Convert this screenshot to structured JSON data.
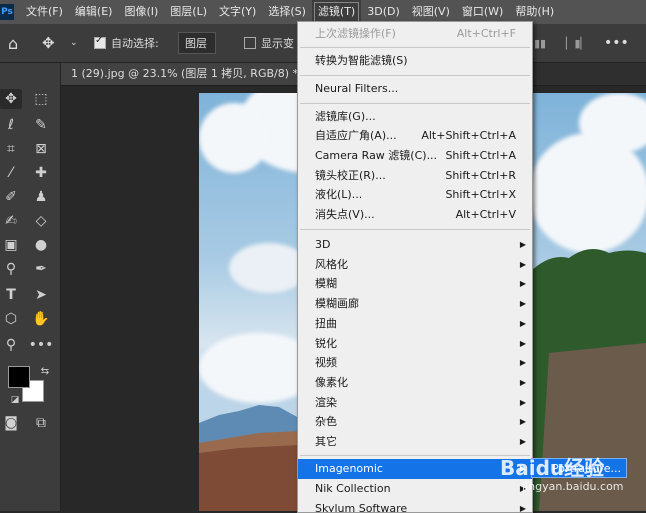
{
  "menubar": {
    "logo": "Ps",
    "items": [
      "文件(F)",
      "编辑(E)",
      "图像(I)",
      "图层(L)",
      "文字(Y)",
      "选择(S)",
      "滤镜(T)",
      "3D(D)",
      "视图(V)",
      "窗口(W)",
      "帮助(H)"
    ]
  },
  "optbar": {
    "auto_select_label": "自动选择:",
    "auto_select_value": "图层",
    "show_transform_label": "显示变"
  },
  "document": {
    "tab_title": "1 (29).jpg @ 23.1% (图层 1 拷贝, RGB/8) *"
  },
  "filter_menu": {
    "items": [
      {
        "label": "上次滤镜操作(F)",
        "shortcut": "Alt+Ctrl+F",
        "disabled": true
      },
      {
        "label": "转换为智能滤镜(S)",
        "shortcut": ""
      },
      {
        "label": "Neural Filters...",
        "shortcut": ""
      },
      {
        "label": "滤镜库(G)...",
        "shortcut": ""
      },
      {
        "label": "自适应广角(A)...",
        "shortcut": "Alt+Shift+Ctrl+A"
      },
      {
        "label": "Camera Raw 滤镜(C)...",
        "shortcut": "Shift+Ctrl+A"
      },
      {
        "label": "镜头校正(R)...",
        "shortcut": "Shift+Ctrl+R"
      },
      {
        "label": "液化(L)...",
        "shortcut": "Shift+Ctrl+X"
      },
      {
        "label": "消失点(V)...",
        "shortcut": "Alt+Ctrl+V"
      },
      {
        "label": "3D",
        "submenu": true
      },
      {
        "label": "风格化",
        "submenu": true
      },
      {
        "label": "模糊",
        "submenu": true
      },
      {
        "label": "模糊画廊",
        "submenu": true
      },
      {
        "label": "扭曲",
        "submenu": true
      },
      {
        "label": "锐化",
        "submenu": true
      },
      {
        "label": "视频",
        "submenu": true
      },
      {
        "label": "像素化",
        "submenu": true
      },
      {
        "label": "渲染",
        "submenu": true
      },
      {
        "label": "杂色",
        "submenu": true
      },
      {
        "label": "其它",
        "submenu": true
      },
      {
        "label": "Imagenomic",
        "submenu": true,
        "highlight": true
      },
      {
        "label": "Nik Collection",
        "submenu": true
      },
      {
        "label": "Skylum Software",
        "submenu": true
      }
    ]
  },
  "submenu": {
    "label": "Portraiture..."
  },
  "watermark": {
    "logo": "Baidu经验",
    "url": "jingyan.baidu.com"
  },
  "colors": {
    "highlight": "#1473e6",
    "menu_bg": "#efefef"
  }
}
